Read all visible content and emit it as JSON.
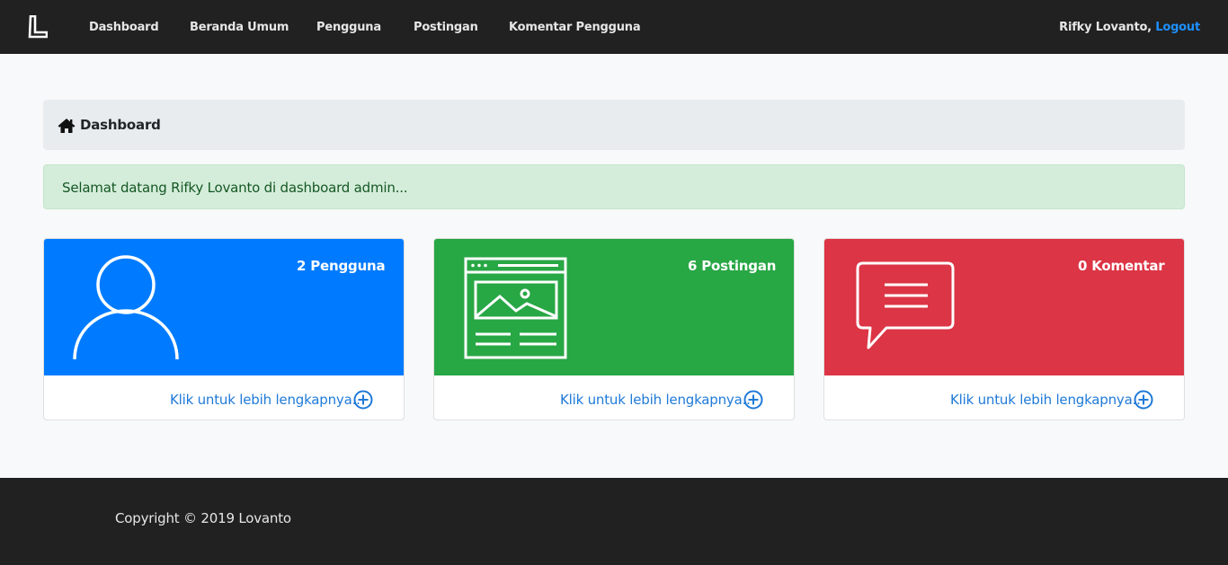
{
  "navbar": {
    "brand_icon": "L-logo-icon",
    "links": [
      {
        "label": "Dashboard"
      },
      {
        "label": "Beranda Umum"
      },
      {
        "label": "Pengguna"
      },
      {
        "label": "Postingan"
      },
      {
        "label": "Komentar Pengguna"
      }
    ],
    "user_name": "Rifky Lovanto,",
    "logout_label": "Logout"
  },
  "breadcrumb": {
    "icon": "home-icon",
    "label": "Dashboard"
  },
  "alert": {
    "message": "Selamat datang Rifky Lovanto di dashboard admin..."
  },
  "cards": [
    {
      "count": "2 Pengguna",
      "icon": "user-icon",
      "color": "#007bff",
      "more_label": "Klik untuk lebih lengkapnya..",
      "more_icon": "plus-circle-icon"
    },
    {
      "count": "6 Postingan",
      "icon": "webpage-icon",
      "color": "#28a745",
      "more_label": "Klik untuk lebih lengkapnya..",
      "more_icon": "plus-circle-icon"
    },
    {
      "count": "0 Komentar",
      "icon": "chat-bubble-icon",
      "color": "#dc3545",
      "more_label": "Klik untuk lebih lengkapnya..",
      "more_icon": "plus-circle-icon"
    }
  ],
  "footer": {
    "copyright": "Copyright © 2019 Lovanto"
  },
  "colors": {
    "navbar_bg": "#212121",
    "link_accent": "#1e90ff",
    "alert_bg": "#d4edda",
    "alert_text": "#155724"
  }
}
